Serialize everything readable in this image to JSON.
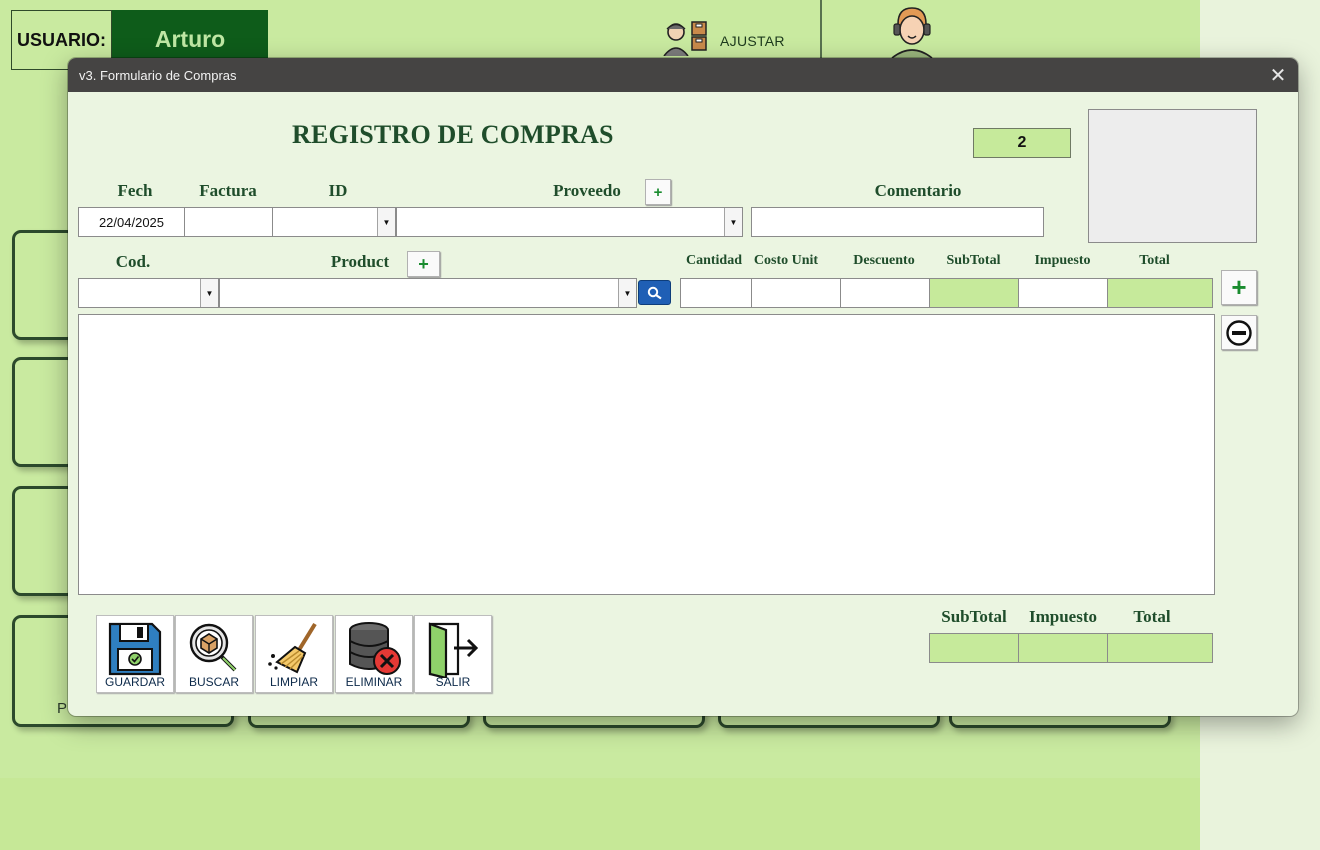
{
  "background": {
    "user_label": "USUARIO:",
    "user_name": "Arturo",
    "ajustar_label": "AJUSTAR",
    "card_label_p": "P"
  },
  "window": {
    "title": "v3. Formulario de Compras",
    "close_glyph": "✕"
  },
  "form": {
    "heading": "REGISTRO DE COMPRAS",
    "record_count": "2",
    "labels": {
      "fecha": "Fech",
      "factura": "Factura",
      "id": "ID",
      "proveedor": "Proveedo",
      "comentario": "Comentario",
      "cod": "Cod.",
      "product": "Product",
      "cantidad": "Cantidad",
      "costo_unit": "Costo Unit",
      "descuento": "Descuento",
      "subtotal": "SubTotal",
      "impuesto": "Impuesto",
      "total": "Total"
    },
    "values": {
      "fecha": "22/04/2025",
      "factura": "",
      "id": "",
      "proveedor": "",
      "comentario": "",
      "cod": "",
      "product": "",
      "cantidad": "",
      "costo_unit": "",
      "descuento": "",
      "subtotal": "",
      "impuesto": "",
      "total": ""
    },
    "totals": {
      "subtotal_label": "SubTotal",
      "impuesto_label": "Impuesto",
      "total_label": "Total",
      "subtotal": "",
      "impuesto": "",
      "total": ""
    },
    "add_glyph": "+",
    "dropdown_glyph": "▼"
  },
  "toolbar": {
    "guardar": "GUARDAR",
    "buscar": "BUSCAR",
    "limpiar": "LIMPIAR",
    "eliminar": "ELIMINAR",
    "salir": "SALIR"
  },
  "colors": {
    "background_green": "#c9eaa0",
    "dialog_bg": "#ebf5e1",
    "heading_green": "#1f4d2b",
    "field_green": "#c6ea9b",
    "user_badge": "#0e5c1a",
    "titlebar": "#454443"
  }
}
